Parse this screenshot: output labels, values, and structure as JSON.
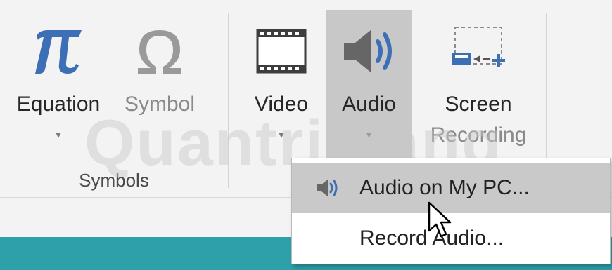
{
  "ribbon": {
    "buttons": {
      "equation": {
        "label": "Equation",
        "dropdown": "▾",
        "icon": "pi-icon",
        "color": "#3c6fb5"
      },
      "symbol": {
        "label": "Symbol",
        "icon": "omega-icon"
      },
      "video": {
        "label": "Video",
        "dropdown": "▾",
        "icon": "film-icon"
      },
      "audio": {
        "label": "Audio",
        "dropdown": "▾",
        "icon": "speaker-icon"
      },
      "screen_recording": {
        "label_line1": "Screen",
        "label_line2": "Recording",
        "icon": "screen-recording-icon"
      }
    },
    "groups": {
      "symbols": "Symbols"
    }
  },
  "audio_menu": {
    "items": [
      {
        "label": "Audio on My PC...",
        "icon": "speaker-icon",
        "highlighted": true
      },
      {
        "label": "Record Audio..."
      }
    ]
  },
  "watermark": {
    "text": "Quantrimang"
  },
  "colors": {
    "accent_blue": "#3c6fb5",
    "teal": "#2ea0aa",
    "highlight_gray": "#c9c9c9"
  }
}
